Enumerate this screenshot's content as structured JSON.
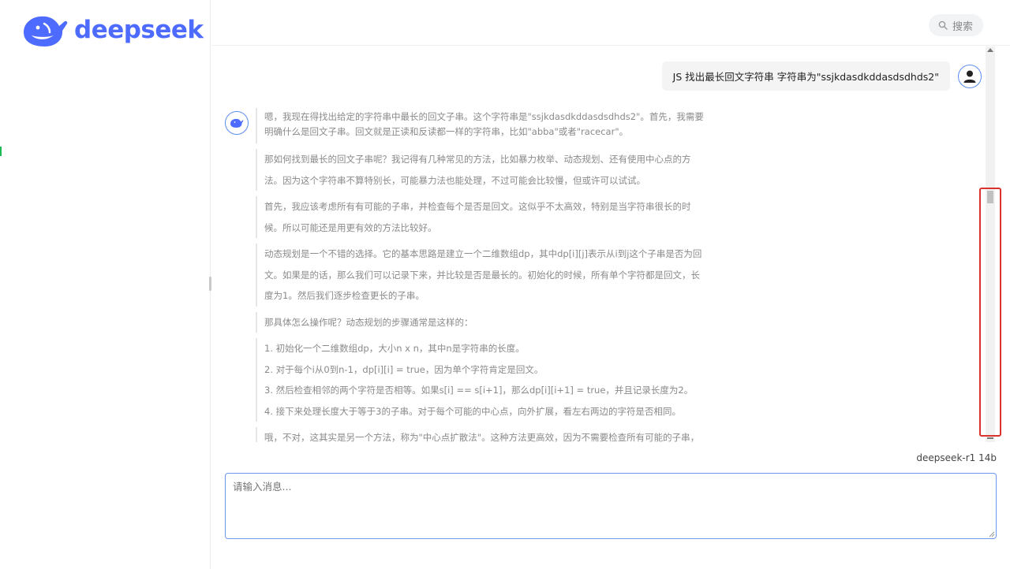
{
  "brand": {
    "name": "deepseek",
    "color": "#4d6bfe"
  },
  "search": {
    "icon": "search-icon",
    "label": "搜索"
  },
  "user_message": "JS 找出最长回文字符串 字符串为\"ssjkdasdkddasdsdhds2\"",
  "assistant_paragraphs": [
    "嗯，我现在得找出给定的字符串中最长的回文子串。这个字符串是\"ssjkdasdkddasdsdhds2\"。首先，我需要明确什么是回文子串。回文就是正读和反读都一样的字符串，比如\"abba\"或者\"racecar\"。",
    "那如何找到最长的回文子串呢？我记得有几种常见的方法，比如暴力枚举、动态规划、还有使用中心点的方法。因为这个字符串不算特别长，可能暴力法也能处理，不过可能会比较慢，但或许可以试试。",
    "首先，我应该考虑所有有可能的子串，并检查每个是否是回文。这似乎不太高效，特别是当字符串很长的时候。所以可能还是用更有效的方法比较好。",
    "动态规划是一个不错的选择。它的基本思路是建立一个二维数组dp，其中dp[i][j]表示从i到j这个子串是否为回文。如果是的话，那么我们可以记录下来，并比较是否是最长的。初始化的时候，所有单个字符都是回文，长度为1。然后我们逐步检查更长的子串。",
    "那具体怎么操作呢？动态规划的步骤通常是这样的：",
    "1. 初始化一个二维数组dp，大小n x n，其中n是字符串的长度。\n2. 对于每个i从0到n-1，dp[i][i] = true，因为单个字符肯定是回文。\n3. 然后检查相邻的两个字符是否相等。如果s[i] == s[i+1]，那么dp[i][i+1] = true，并且记录长度为2。\n4. 接下来处理长度大于等于3的子串。对于每个可能的中心点，向外扩展，看左右两边的字符是否相同。",
    "哦，不对，这其实是另一个方法，称为\"中心点扩散法\"。这种方法更高效，因为不需要检查所有可能的子串，而是以"
  ],
  "model_name": "deepseek-r1 14b",
  "input": {
    "placeholder": "请输入消息..."
  },
  "colors": {
    "accent": "#4d6bfe",
    "avatar_border": "#5b8def",
    "highlight": "#d9332b"
  }
}
